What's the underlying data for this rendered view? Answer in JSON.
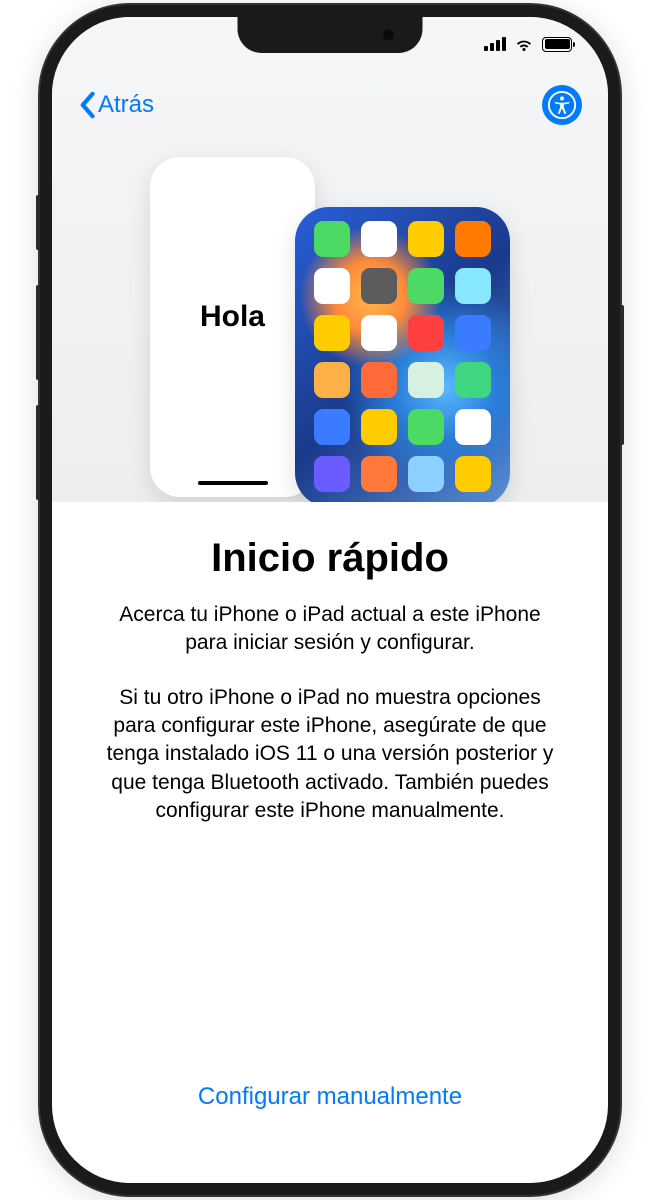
{
  "nav": {
    "back_label": "Atrás"
  },
  "hero": {
    "new_phone_greeting": "Hola",
    "app_colors": [
      "#4cd964",
      "#ffffff",
      "#ffcc00",
      "#ff7a00",
      "#ffffff",
      "#5c5c5c",
      "#4cd964",
      "#87e8ff",
      "#ffcc00",
      "#ffffff",
      "#ff4040",
      "#3a7bff",
      "#fcb045",
      "#ff6a3a",
      "#d8f0e0",
      "#3ed67f",
      "#3a7bff",
      "#ffcc00",
      "#4cd964",
      "#ffffff",
      "#6a5cff",
      "#ff7a3a",
      "#8cd0ff",
      "#ffcc00"
    ]
  },
  "content": {
    "title": "Inicio rápido",
    "body1": "Acerca tu iPhone o iPad actual a este iPhone para iniciar sesión y configurar.",
    "body2": "Si tu otro iPhone o iPad no muestra opciones para configurar este iPhone, asegúrate de que tenga instalado iOS 11 o una versión posterior y que tenga Bluetooth activado. También puedes configurar este iPhone manualmente."
  },
  "footer": {
    "manual_label": "Configurar manualmente"
  }
}
